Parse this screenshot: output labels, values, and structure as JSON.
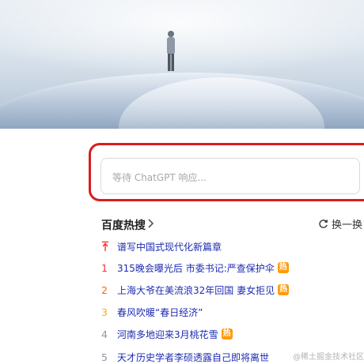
{
  "chatgpt": {
    "placeholder": "等待 ChatGPT 响应..."
  },
  "hot": {
    "title": "百度热搜",
    "refresh_label": "换一换",
    "items": [
      {
        "rank": "",
        "text": "谱写中国式现代化新篇章",
        "hot": false,
        "pinned": true
      },
      {
        "rank": "1",
        "text": "315晚会曝光后 市委书记:严查保护伞",
        "hot": true
      },
      {
        "rank": "2",
        "text": "上海大爷在美流浪32年回国 妻女拒见",
        "hot": true
      },
      {
        "rank": "3",
        "text": "春风吹暖“春日经济”",
        "hot": false
      },
      {
        "rank": "4",
        "text": "河南多地迎来3月桃花雪",
        "hot": true
      },
      {
        "rank": "5",
        "text": "天才历史学者李硕透露自己即将离世",
        "hot": false
      }
    ],
    "hot_label": "热"
  },
  "watermark": "@稀土掘金技术社区",
  "colors": {
    "highlight_border": "#d81e1e",
    "hot_badge": "#ff9a0b",
    "link": "#1c2bb2"
  }
}
